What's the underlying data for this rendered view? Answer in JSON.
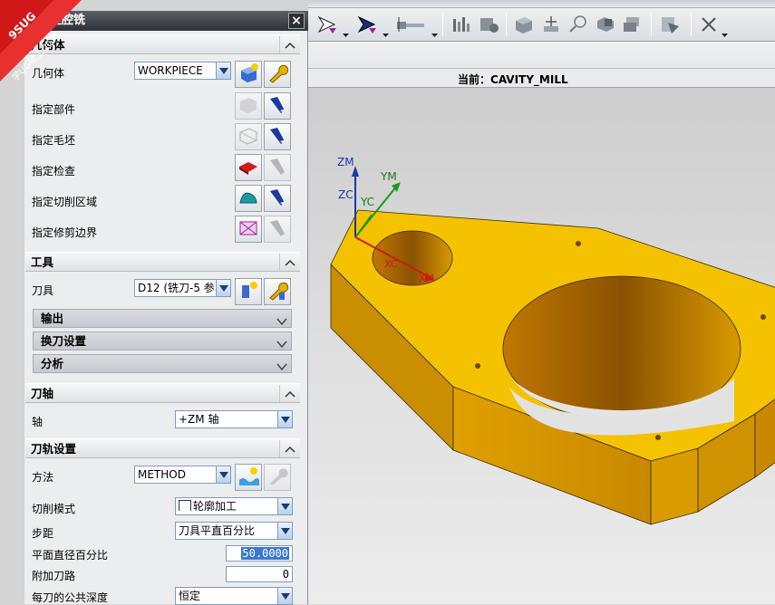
{
  "dialog": {
    "title": "型腔铣",
    "close_label": "×",
    "sections": {
      "geometry": {
        "title": "几何体",
        "geometry_label": "几何体",
        "geometry_value": "WORKPIECE",
        "rows": [
          "指定部件",
          "指定毛坯",
          "指定检查",
          "指定切削区域",
          "指定修剪边界"
        ]
      },
      "tool": {
        "title": "工具",
        "tool_label": "刀具",
        "tool_value": "D12 (铣刀-5 参",
        "subpanels": [
          "输出",
          "换刀设置",
          "分析"
        ]
      },
      "axis": {
        "title": "刀轴",
        "axis_label": "轴",
        "axis_value": "+ZM 轴"
      },
      "path": {
        "title": "刀轨设置",
        "method_label": "方法",
        "method_value": "METHOD",
        "cut_pattern_label": "切削模式",
        "cut_pattern_value": "轮廓加工",
        "stepover_label": "步距",
        "stepover_value": "刀具平直百分比",
        "percent_label": "平面直径百分比",
        "percent_value": "50.0000",
        "additional_label": "附加刀路",
        "additional_value": "0",
        "depth_label": "每刀的公共深度",
        "depth_value": "恒定"
      }
    }
  },
  "status": {
    "current_operation_prefix": "当前：",
    "current_operation": "CAVITY_MILL"
  },
  "viewport": {
    "axes": {
      "zm": "ZM",
      "zc": "ZC",
      "yc": "YC",
      "ym": "YM",
      "xc": "XC",
      "xm": "XM"
    },
    "part_color": "#f5c200",
    "part_side_color": "#d89a00"
  },
  "watermark": {
    "line1": "9SUG",
    "line2": "学UG就上UG网"
  }
}
